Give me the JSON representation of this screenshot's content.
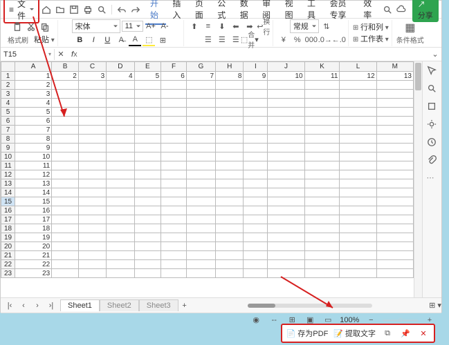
{
  "topbar": {
    "file_label": "文件",
    "share_label": "分享"
  },
  "menu": {
    "tabs": [
      "开始",
      "插入",
      "页面",
      "公式",
      "数据",
      "审阅",
      "视图",
      "工具",
      "会员专享",
      "效率"
    ]
  },
  "ribbon": {
    "format_painter": "格式刷",
    "paste": "粘贴",
    "font_name": "宋体",
    "font_size": "11",
    "general": "常规",
    "wrap": "换行",
    "rowcol": "行和列",
    "merge": "合并",
    "worksheet": "工作表",
    "cond_fmt": "条件格式"
  },
  "namebox": {
    "cell_ref": "T15"
  },
  "columns": [
    "A",
    "B",
    "C",
    "D",
    "E",
    "F",
    "G",
    "H",
    "I",
    "J",
    "K",
    "L",
    "M"
  ],
  "row1_values": [
    "1",
    "2",
    "3",
    "4",
    "5",
    "6",
    "7",
    "8",
    "9",
    "10",
    "11",
    "12",
    "13"
  ],
  "colA_values": [
    "1",
    "2",
    "3",
    "4",
    "5",
    "6",
    "7",
    "8",
    "9",
    "10",
    "11",
    "12",
    "13",
    "14",
    "15",
    "16",
    "17",
    "18",
    "19",
    "20",
    "21",
    "22",
    "23"
  ],
  "selected_row": 15,
  "sheets": {
    "tabs": [
      "Sheet1",
      "Sheet2",
      "Sheet3"
    ]
  },
  "status": {
    "zoom": "100%"
  },
  "callout": {
    "pdf": "存为PDF",
    "ocr": "提取文字"
  }
}
